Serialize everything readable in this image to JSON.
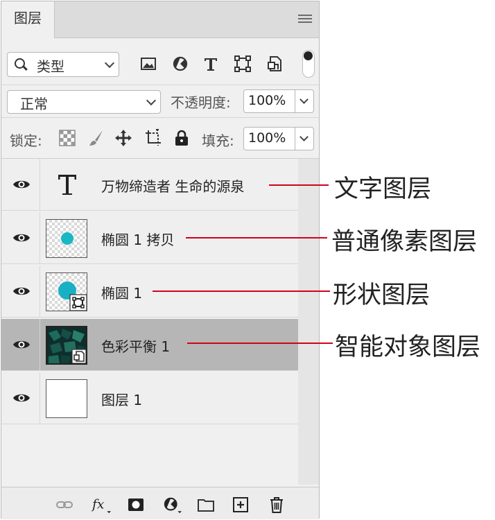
{
  "panel": {
    "tab_label": "图层",
    "menu_icon": "hamburger-icon"
  },
  "filter": {
    "kind_select": "类型",
    "icons": [
      "image-filter-icon",
      "adjustment-filter-icon",
      "type-filter-icon",
      "shape-filter-icon",
      "smart-object-filter-icon"
    ]
  },
  "blend": {
    "mode": "正常",
    "opacity_label": "不透明度:",
    "opacity_value": "100%"
  },
  "lock": {
    "label": "锁定:",
    "icons": [
      "lock-transparent-icon",
      "lock-brush-icon",
      "lock-move-icon",
      "lock-artboard-icon",
      "lock-all-icon"
    ],
    "fill_label": "填充:",
    "fill_value": "100%"
  },
  "layers": [
    {
      "name": "万物缔造者 生命的源泉",
      "kind": "text"
    },
    {
      "name": "椭圆 1 拷贝",
      "kind": "pixel"
    },
    {
      "name": "椭圆 1",
      "kind": "shape"
    },
    {
      "name": "色彩平衡 1",
      "kind": "smart",
      "selected": true
    },
    {
      "name": "图层 1",
      "kind": "white"
    }
  ],
  "callouts": [
    "文字图层",
    "普通像素图层",
    "形状图层",
    "智能对象图层"
  ],
  "bottom_icons": [
    "link-icon",
    "fx-icon",
    "mask-icon",
    "adjustment-icon",
    "folder-icon",
    "new-layer-icon",
    "trash-icon"
  ],
  "colors": {
    "accent_line": "#d0021b",
    "teal_dot": "#1ab7c4"
  }
}
